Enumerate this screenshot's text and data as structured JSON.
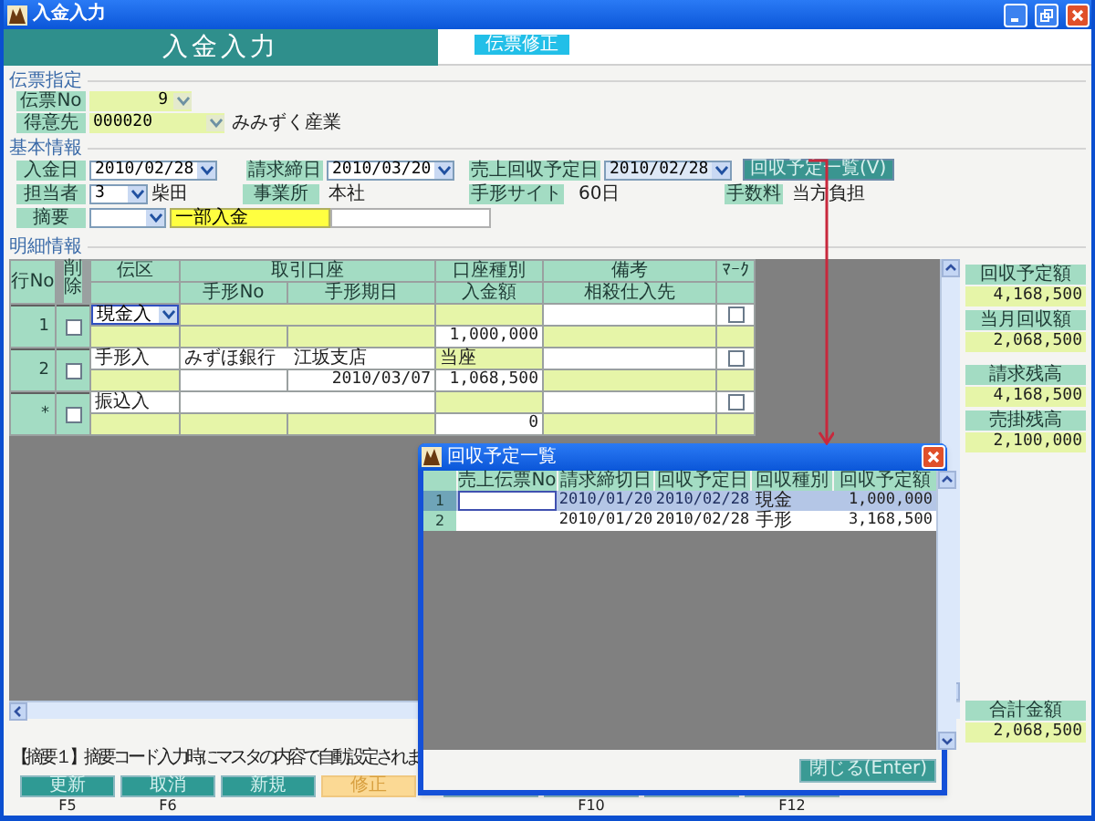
{
  "window": {
    "title": "入金入力"
  },
  "header": {
    "title": "入金入力",
    "mode_badge": "伝票修正"
  },
  "slip": {
    "title": "伝票指定",
    "slip_no": {
      "label": "伝票No",
      "value": "9"
    },
    "customer": {
      "label": "得意先",
      "code": "000020",
      "name": "みみずく産業"
    }
  },
  "basic_info": {
    "title": "基本情報",
    "deposit_date": {
      "label": "入金日",
      "value": "2010/02/28"
    },
    "closing_date": {
      "label": "請求締日",
      "value": "2010/03/20"
    },
    "due_date": {
      "label": "売上回収予定日",
      "value": "2010/02/28"
    },
    "schedule_button": "回収予定一覧(V)",
    "staff": {
      "label": "担当者",
      "code": "3",
      "name": "柴田"
    },
    "office": {
      "label": "事業所",
      "value": "本社"
    },
    "bill_term": {
      "label": "手形サイト",
      "value": "60日"
    },
    "fee": {
      "label": "手数料",
      "value": "当方負担"
    },
    "summary": {
      "label": "摘要",
      "value": "一部入金"
    }
  },
  "detail": {
    "title": "明細情報",
    "header_top": [
      "行No",
      "削除",
      "伝区",
      "取引口座",
      "口座種別",
      "備考",
      "ﾏｰｸ"
    ],
    "header_bottom": [
      "手形No",
      "手形期日",
      "入金額",
      "相殺仕入先"
    ],
    "rows": [
      {
        "row_no": "1",
        "kind": "cash",
        "focused": true,
        "deleted": false,
        "marked": false,
        "type": "現金入",
        "amount": "1,000,000"
      },
      {
        "row_no": "2",
        "kind": "bill",
        "focused": false,
        "deleted": false,
        "marked": false,
        "type": "手形入",
        "account": "みずほ銀行　江坂支店",
        "account_type": "当座",
        "bill_date": "2010/03/07",
        "amount": "1,068,500"
      },
      {
        "row_no": "*",
        "kind": "transfer",
        "focused": false,
        "deleted": false,
        "marked": false,
        "type": "振込入",
        "amount": "0"
      }
    ]
  },
  "summary_panel": {
    "groups": [
      [
        {
          "label": "回収予定額",
          "value": "4,168,500"
        },
        {
          "label": "当月回収額",
          "value": "2,068,500"
        }
      ],
      [
        {
          "label": "請求残高",
          "value": "4,168,500"
        },
        {
          "label": "売掛残高",
          "value": "2,100,000"
        }
      ]
    ],
    "grand_total": {
      "label": "合計金額",
      "value": "2,068,500"
    }
  },
  "message": "【摘要１】摘要コード入力時にマスタの内容で自動設定されま",
  "function_keys": [
    {
      "label": "更新",
      "key": "F5",
      "selected": false
    },
    {
      "label": "取消",
      "key": "F6",
      "selected": false
    },
    {
      "label": "新規",
      "selected": false
    },
    {
      "label": "修正",
      "selected": true
    },
    {
      "selected": false
    },
    {
      "key": "F10",
      "selected": false
    },
    {
      "selected": false
    },
    {
      "key": "F12",
      "selected": false
    }
  ],
  "dialog": {
    "title": "回収予定一覧",
    "columns": [
      "売上伝票No",
      "請求締切日",
      "回収予定日",
      "回収種別",
      "回収予定額"
    ],
    "rows": [
      {
        "row_no": "1",
        "selected": true,
        "closing_date": "2010/01/20",
        "due_date": "2010/02/28",
        "method": "現金",
        "amount": "1,000,000"
      },
      {
        "row_no": "2",
        "selected": false,
        "closing_date": "2010/01/20",
        "due_date": "2010/02/28",
        "method": "手形",
        "amount": "3,168,500"
      }
    ],
    "close_button": "閉じる(Enter)"
  }
}
